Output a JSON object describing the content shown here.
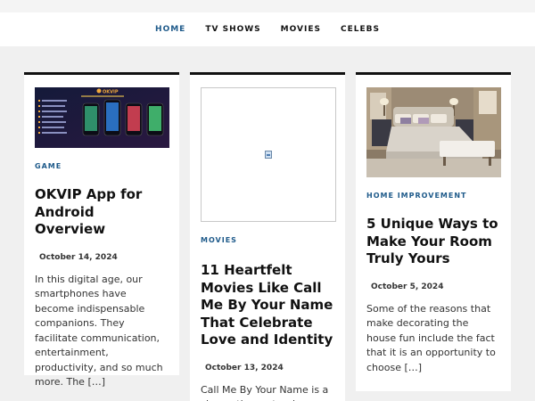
{
  "nav": {
    "items": [
      {
        "label": "HOME",
        "active": true
      },
      {
        "label": "TV SHOWS",
        "active": false
      },
      {
        "label": "MOVIES",
        "active": false
      },
      {
        "label": "CELEBS",
        "active": false
      }
    ]
  },
  "colors": {
    "accent": "#1e5a8a",
    "page_bg": "#f0f0f0",
    "card_border": "#111111"
  },
  "posts": [
    {
      "category": "GAME",
      "title": "OKVIP App for Android Overview",
      "date": "October 14, 2024",
      "excerpt": "In this digital age, our smartphones have become indispensable companions. They facilitate communication, entertainment, productivity, and so much more. The […]",
      "image": "app-promo-banner",
      "image_text": "OKVIP"
    },
    {
      "category": "MOVIES",
      "title": "11 Heartfelt Movies Like Call Me By Your Name That Celebrate Love and Identity",
      "date": "October 13, 2024",
      "excerpt": "Call Me By Your Name is a cinematic masterpiece",
      "image": "broken-image-icon"
    },
    {
      "category": "HOME IMPROVEMENT",
      "title": "5 Unique Ways to Make Your Room Truly Yours",
      "date": "October 5, 2024",
      "excerpt": "Some of the reasons that make decorating the house fun include the fact that it is an opportunity to choose […]",
      "image": "bedroom-photo"
    }
  ]
}
